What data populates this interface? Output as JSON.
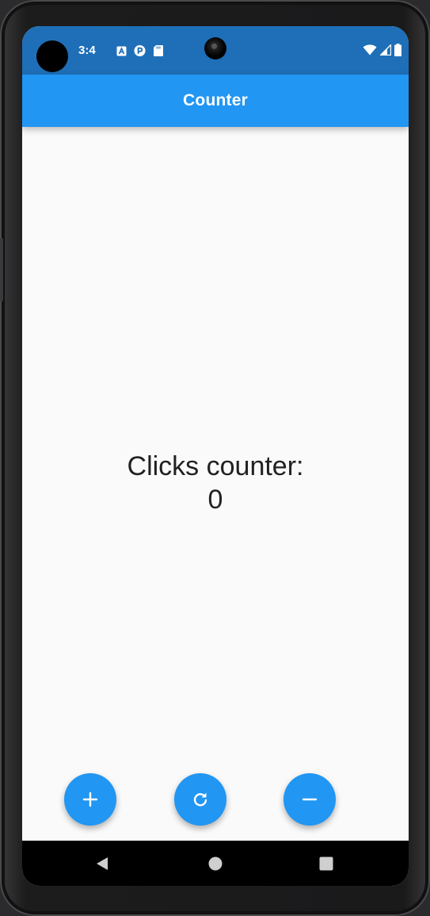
{
  "status_bar": {
    "time": "3:4",
    "notification_icons": [
      "a-icon",
      "p-icon",
      "sd-card-icon"
    ],
    "system_icons": [
      "wifi-icon",
      "signal-icon",
      "battery-icon"
    ]
  },
  "app_bar": {
    "title": "Counter"
  },
  "main": {
    "label": "Clicks counter:",
    "value": "0"
  },
  "fabs": [
    {
      "name": "increment-button",
      "icon": "plus-icon"
    },
    {
      "name": "reset-button",
      "icon": "refresh-icon"
    },
    {
      "name": "decrement-button",
      "icon": "minus-icon"
    }
  ],
  "nav_bar": {
    "buttons": [
      "back-icon",
      "home-icon",
      "recents-icon"
    ]
  },
  "colors": {
    "primary": "#2196f3",
    "status_bar": "#1e6fb8",
    "background": "#fafafa"
  }
}
